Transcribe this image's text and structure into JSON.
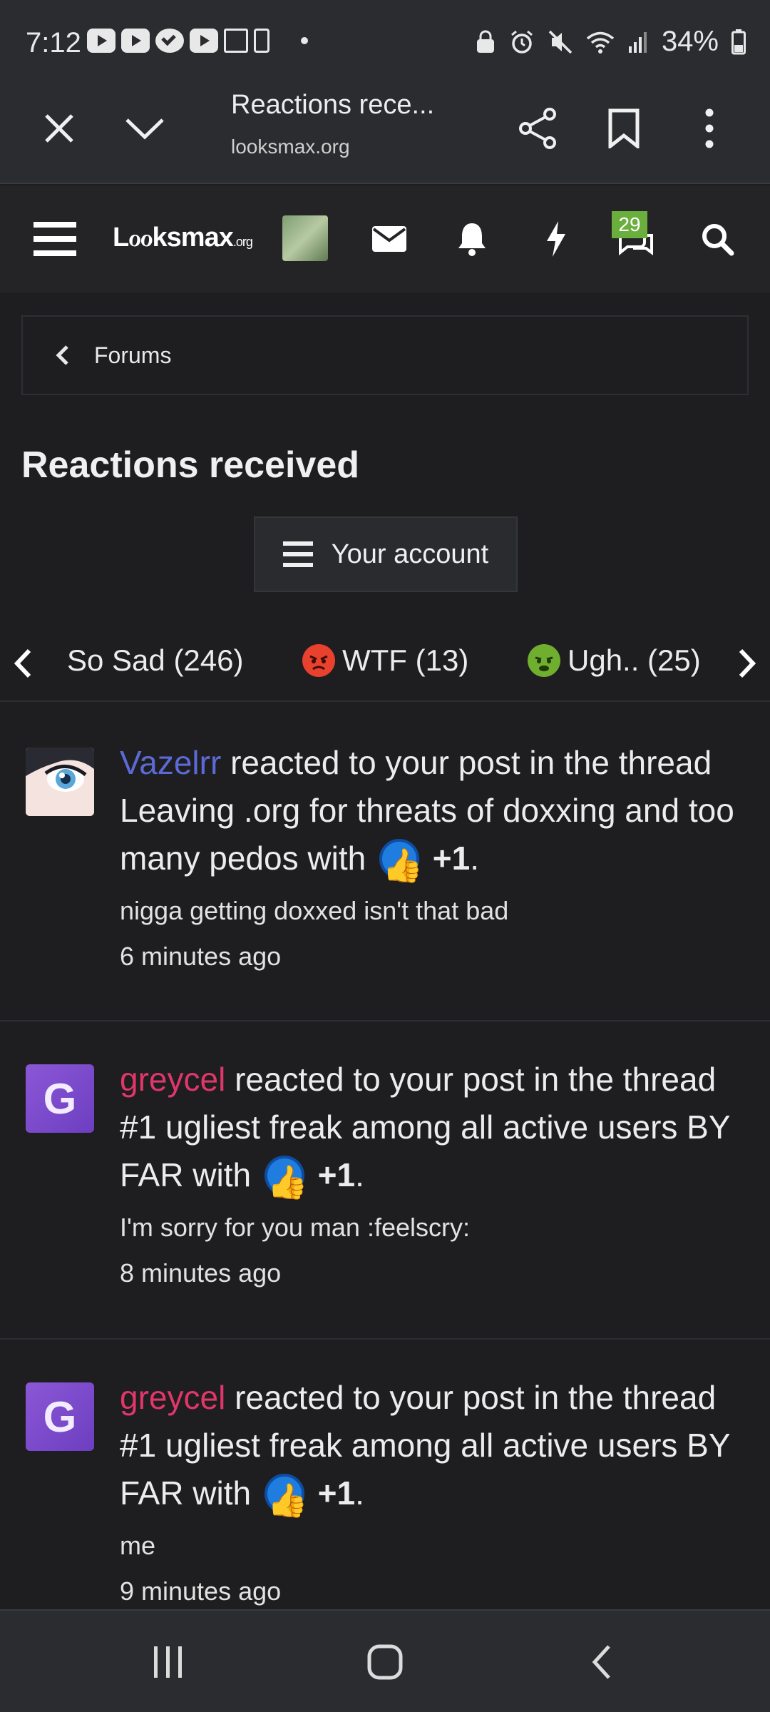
{
  "status_bar": {
    "time": "7:12",
    "battery": "34%",
    "left_icons": [
      "youtube-icon",
      "youtube-icon",
      "check-app-icon",
      "youtube-icon",
      "box-app-icon",
      "phone-app-icon"
    ],
    "right_icons": [
      "lock-icon",
      "alarm-icon",
      "mute-icon",
      "wifi-icon",
      "signal-icon",
      "battery-icon"
    ]
  },
  "browser": {
    "title": "Reactions rece...",
    "url": "looksmax.org"
  },
  "site_nav": {
    "logo_main": "Lℴℴksmax",
    "logo_suffix": ".org",
    "conversations_badge": "29"
  },
  "breadcrumb": {
    "label": "Forums"
  },
  "page": {
    "title": "Reactions received",
    "account_button": "Your account"
  },
  "reaction_tabs": [
    {
      "label": "So Sad (246)",
      "emoji": ""
    },
    {
      "label": "WTF (13)",
      "emoji": "angry-face-icon"
    },
    {
      "label": "Ugh.. (25)",
      "emoji": "nauseated-face-icon"
    }
  ],
  "items": [
    {
      "user": "Vazelrr",
      "action": " reacted to your post in the thread ",
      "thread": "Leaving .org for threats of doxxing and too many pedos",
      "with": " with ",
      "reaction": "+1",
      "snippet": "nigga getting doxxed isn't that bad",
      "time": "6 minutes ago",
      "avatar_letter": ""
    },
    {
      "user": "greycel",
      "action": " reacted to your post in the thread ",
      "thread": "#1 ugliest freak among all active users BY FAR",
      "with": " with ",
      "reaction": "+1",
      "snippet": "I'm sorry for you man :feelscry:",
      "time": "8 minutes ago",
      "avatar_letter": "G"
    },
    {
      "user": "greycel",
      "action": " reacted to your post in the thread ",
      "thread": "#1 ugliest freak among all active users BY FAR",
      "with": " with ",
      "reaction": "+1",
      "snippet": "me",
      "time": "9 minutes ago",
      "avatar_letter": "G"
    }
  ],
  "colors": {
    "background": "#1e1e20",
    "user_blue": "#5b6ad6",
    "user_pink": "#e0366a",
    "badge_green": "#6aae3e",
    "like_blue": "#1f7de0"
  }
}
